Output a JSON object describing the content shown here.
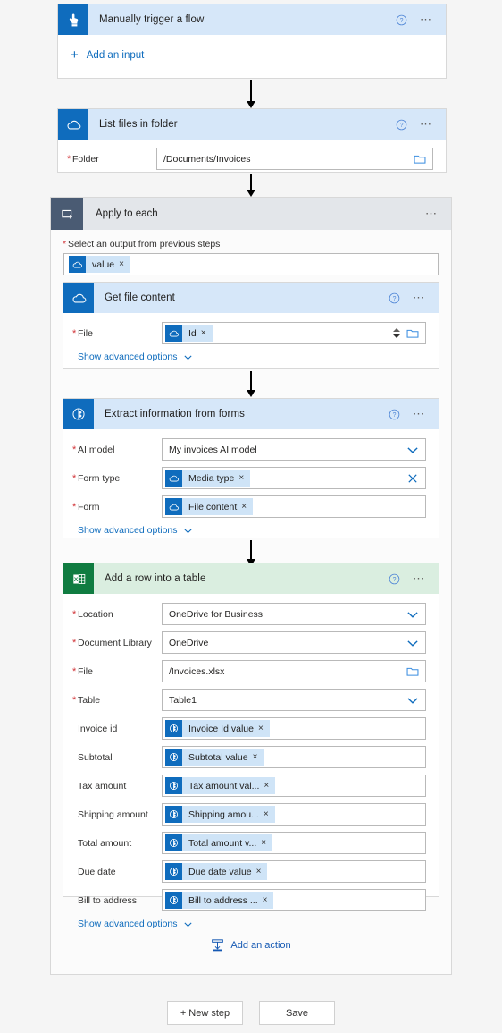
{
  "colors": {
    "accent": "#0f6cbd",
    "header_blue": "#d6e7f9",
    "header_green": "#daeee0",
    "header_slate": "#e3e6ea",
    "required_red": "#d13438",
    "excel_green": "#107c41",
    "loop_icon_bg": "#4a5b73",
    "chip_bg": "#cfe4f7"
  },
  "trigger": {
    "title": "Manually trigger a flow",
    "icon": "hand-pointer-icon",
    "help_icon": "help-circle-icon",
    "menu_icon": "ellipsis-icon",
    "add_input_label": "Add an input",
    "add_input_icon": "plus-icon"
  },
  "list_files": {
    "title": "List files in folder",
    "icon": "onedrive-cloud-icon",
    "help_icon": "help-circle-icon",
    "menu_icon": "ellipsis-icon",
    "fields": [
      {
        "label": "Folder",
        "required": true,
        "type": "text-with-picker",
        "value": "/Documents/Invoices",
        "picker_icon": "folder-icon"
      }
    ]
  },
  "apply_to_each": {
    "title": "Apply to each",
    "icon": "loop-icon",
    "menu_icon": "ellipsis-icon",
    "select_output_label": "Select an output from previous steps",
    "select_output_token": {
      "label": "value",
      "icon": "onedrive-cloud-icon",
      "remove": "×"
    }
  },
  "get_file_content": {
    "title": "Get file content",
    "icon": "onedrive-cloud-icon",
    "help_icon": "help-circle-icon",
    "menu_icon": "ellipsis-icon",
    "fields": [
      {
        "label": "File",
        "required": true,
        "type": "token-with-spinner",
        "token": {
          "label": "Id",
          "icon": "onedrive-cloud-icon",
          "remove": "×"
        },
        "spinner_icon": "spinner-arrows-icon",
        "picker_icon": "folder-icon"
      }
    ],
    "advanced_label": "Show advanced options",
    "advanced_icon": "chevron-down-icon"
  },
  "extract_forms": {
    "title": "Extract information from forms",
    "icon": "ai-builder-icon",
    "help_icon": "help-circle-icon",
    "menu_icon": "ellipsis-icon",
    "fields": [
      {
        "label": "AI model",
        "required": true,
        "type": "dropdown",
        "value": "My invoices AI model",
        "chevron_icon": "chevron-down-icon"
      },
      {
        "label": "Form type",
        "required": true,
        "type": "token-with-clear",
        "token": {
          "label": "Media type",
          "icon": "onedrive-cloud-icon",
          "remove": "×"
        },
        "clear_icon": "clear-x-icon"
      },
      {
        "label": "Form",
        "required": true,
        "type": "token",
        "token": {
          "label": "File content",
          "icon": "onedrive-cloud-icon",
          "remove": "×"
        }
      }
    ],
    "advanced_label": "Show advanced options",
    "advanced_icon": "chevron-down-icon"
  },
  "add_row": {
    "title": "Add a row into a table",
    "icon": "excel-icon",
    "help_icon": "help-circle-icon",
    "menu_icon": "ellipsis-icon",
    "fields": [
      {
        "label": "Location",
        "required": true,
        "type": "dropdown",
        "value": "OneDrive for Business",
        "chevron_icon": "chevron-down-icon"
      },
      {
        "label": "Document Library",
        "required": true,
        "type": "dropdown",
        "value": "OneDrive",
        "chevron_icon": "chevron-down-icon"
      },
      {
        "label": "File",
        "required": true,
        "type": "text-with-picker",
        "value": "/Invoices.xlsx",
        "picker_icon": "folder-icon"
      },
      {
        "label": "Table",
        "required": true,
        "type": "dropdown",
        "value": "Table1",
        "chevron_icon": "chevron-down-icon"
      },
      {
        "label": "Invoice id",
        "required": false,
        "type": "token",
        "token": {
          "label": "Invoice Id value",
          "icon": "ai-builder-icon",
          "remove": "×"
        }
      },
      {
        "label": "Subtotal",
        "required": false,
        "type": "token",
        "token": {
          "label": "Subtotal value",
          "icon": "ai-builder-icon",
          "remove": "×"
        }
      },
      {
        "label": "Tax amount",
        "required": false,
        "type": "token",
        "token": {
          "label": "Tax amount val...",
          "icon": "ai-builder-icon",
          "remove": "×"
        }
      },
      {
        "label": "Shipping amount",
        "required": false,
        "type": "token",
        "token": {
          "label": "Shipping amou...",
          "icon": "ai-builder-icon",
          "remove": "×"
        }
      },
      {
        "label": "Total amount",
        "required": false,
        "type": "token",
        "token": {
          "label": "Total amount v...",
          "icon": "ai-builder-icon",
          "remove": "×"
        }
      },
      {
        "label": "Due date",
        "required": false,
        "type": "token",
        "token": {
          "label": "Due date value",
          "icon": "ai-builder-icon",
          "remove": "×"
        }
      },
      {
        "label": "Bill to address",
        "required": false,
        "type": "token",
        "token": {
          "label": "Bill to address ...",
          "icon": "ai-builder-icon",
          "remove": "×"
        }
      }
    ],
    "advanced_label": "Show advanced options",
    "advanced_icon": "chevron-down-icon"
  },
  "add_action": {
    "label": "Add an action",
    "icon": "add-action-icon"
  },
  "footer": {
    "new_step_label": "+ New step",
    "save_label": "Save"
  }
}
